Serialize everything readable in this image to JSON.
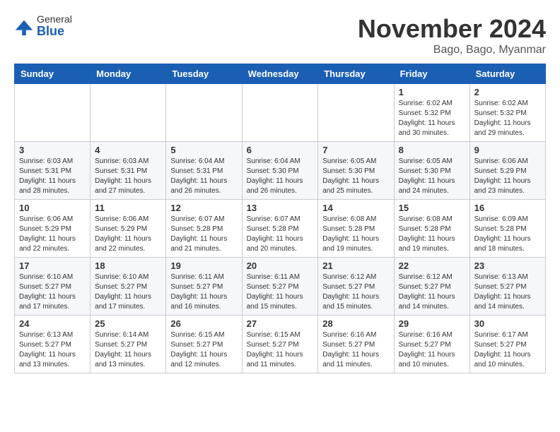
{
  "header": {
    "logo_general": "General",
    "logo_blue": "Blue",
    "month_title": "November 2024",
    "location": "Bago, Bago, Myanmar"
  },
  "columns": [
    "Sunday",
    "Monday",
    "Tuesday",
    "Wednesday",
    "Thursday",
    "Friday",
    "Saturday"
  ],
  "weeks": [
    [
      {
        "day": "",
        "info": ""
      },
      {
        "day": "",
        "info": ""
      },
      {
        "day": "",
        "info": ""
      },
      {
        "day": "",
        "info": ""
      },
      {
        "day": "",
        "info": ""
      },
      {
        "day": "1",
        "info": "Sunrise: 6:02 AM\nSunset: 5:32 PM\nDaylight: 11 hours and 30 minutes."
      },
      {
        "day": "2",
        "info": "Sunrise: 6:02 AM\nSunset: 5:32 PM\nDaylight: 11 hours and 29 minutes."
      }
    ],
    [
      {
        "day": "3",
        "info": "Sunrise: 6:03 AM\nSunset: 5:31 PM\nDaylight: 11 hours and 28 minutes."
      },
      {
        "day": "4",
        "info": "Sunrise: 6:03 AM\nSunset: 5:31 PM\nDaylight: 11 hours and 27 minutes."
      },
      {
        "day": "5",
        "info": "Sunrise: 6:04 AM\nSunset: 5:31 PM\nDaylight: 11 hours and 26 minutes."
      },
      {
        "day": "6",
        "info": "Sunrise: 6:04 AM\nSunset: 5:30 PM\nDaylight: 11 hours and 26 minutes."
      },
      {
        "day": "7",
        "info": "Sunrise: 6:05 AM\nSunset: 5:30 PM\nDaylight: 11 hours and 25 minutes."
      },
      {
        "day": "8",
        "info": "Sunrise: 6:05 AM\nSunset: 5:30 PM\nDaylight: 11 hours and 24 minutes."
      },
      {
        "day": "9",
        "info": "Sunrise: 6:06 AM\nSunset: 5:29 PM\nDaylight: 11 hours and 23 minutes."
      }
    ],
    [
      {
        "day": "10",
        "info": "Sunrise: 6:06 AM\nSunset: 5:29 PM\nDaylight: 11 hours and 22 minutes."
      },
      {
        "day": "11",
        "info": "Sunrise: 6:06 AM\nSunset: 5:29 PM\nDaylight: 11 hours and 22 minutes."
      },
      {
        "day": "12",
        "info": "Sunrise: 6:07 AM\nSunset: 5:28 PM\nDaylight: 11 hours and 21 minutes."
      },
      {
        "day": "13",
        "info": "Sunrise: 6:07 AM\nSunset: 5:28 PM\nDaylight: 11 hours and 20 minutes."
      },
      {
        "day": "14",
        "info": "Sunrise: 6:08 AM\nSunset: 5:28 PM\nDaylight: 11 hours and 19 minutes."
      },
      {
        "day": "15",
        "info": "Sunrise: 6:08 AM\nSunset: 5:28 PM\nDaylight: 11 hours and 19 minutes."
      },
      {
        "day": "16",
        "info": "Sunrise: 6:09 AM\nSunset: 5:28 PM\nDaylight: 11 hours and 18 minutes."
      }
    ],
    [
      {
        "day": "17",
        "info": "Sunrise: 6:10 AM\nSunset: 5:27 PM\nDaylight: 11 hours and 17 minutes."
      },
      {
        "day": "18",
        "info": "Sunrise: 6:10 AM\nSunset: 5:27 PM\nDaylight: 11 hours and 17 minutes."
      },
      {
        "day": "19",
        "info": "Sunrise: 6:11 AM\nSunset: 5:27 PM\nDaylight: 11 hours and 16 minutes."
      },
      {
        "day": "20",
        "info": "Sunrise: 6:11 AM\nSunset: 5:27 PM\nDaylight: 11 hours and 15 minutes."
      },
      {
        "day": "21",
        "info": "Sunrise: 6:12 AM\nSunset: 5:27 PM\nDaylight: 11 hours and 15 minutes."
      },
      {
        "day": "22",
        "info": "Sunrise: 6:12 AM\nSunset: 5:27 PM\nDaylight: 11 hours and 14 minutes."
      },
      {
        "day": "23",
        "info": "Sunrise: 6:13 AM\nSunset: 5:27 PM\nDaylight: 11 hours and 14 minutes."
      }
    ],
    [
      {
        "day": "24",
        "info": "Sunrise: 6:13 AM\nSunset: 5:27 PM\nDaylight: 11 hours and 13 minutes."
      },
      {
        "day": "25",
        "info": "Sunrise: 6:14 AM\nSunset: 5:27 PM\nDaylight: 11 hours and 13 minutes."
      },
      {
        "day": "26",
        "info": "Sunrise: 6:15 AM\nSunset: 5:27 PM\nDaylight: 11 hours and 12 minutes."
      },
      {
        "day": "27",
        "info": "Sunrise: 6:15 AM\nSunset: 5:27 PM\nDaylight: 11 hours and 11 minutes."
      },
      {
        "day": "28",
        "info": "Sunrise: 6:16 AM\nSunset: 5:27 PM\nDaylight: 11 hours and 11 minutes."
      },
      {
        "day": "29",
        "info": "Sunrise: 6:16 AM\nSunset: 5:27 PM\nDaylight: 11 hours and 10 minutes."
      },
      {
        "day": "30",
        "info": "Sunrise: 6:17 AM\nSunset: 5:27 PM\nDaylight: 11 hours and 10 minutes."
      }
    ]
  ]
}
